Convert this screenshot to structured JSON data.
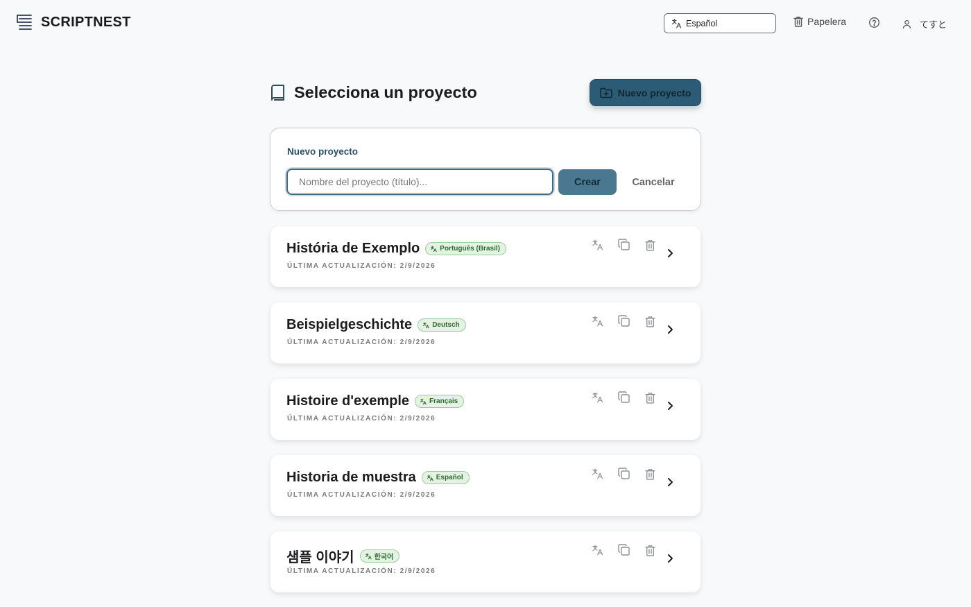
{
  "header": {
    "brand": "SCRIPTNEST",
    "language_selector": "Español",
    "trash_label": "Papelera",
    "user_name": "てすと"
  },
  "page": {
    "title": "Selecciona un proyecto",
    "new_project_button": "Nuevo proyecto"
  },
  "form": {
    "label": "Nuevo proyecto",
    "input_placeholder": "Nombre del proyecto (título)...",
    "input_value": "",
    "create_label": "Crear",
    "cancel_label": "Cancelar"
  },
  "projects": [
    {
      "title": "História de Exemplo",
      "language": "Português (Brasil)",
      "updated": "ÚLTIMA ACTUALIZACIÓN: 2/9/2026"
    },
    {
      "title": "Beispielgeschichte",
      "language": "Deutsch",
      "updated": "ÚLTIMA ACTUALIZACIÓN: 2/9/2026"
    },
    {
      "title": "Histoire d'exemple",
      "language": "Français",
      "updated": "ÚLTIMA ACTUALIZACIÓN: 2/9/2026"
    },
    {
      "title": "Historia de muestra",
      "language": "Español",
      "updated": "ÚLTIMA ACTUALIZACIÓN: 2/9/2026"
    },
    {
      "title": "샘플 이야기",
      "language": "한국어",
      "updated": "ÚLTIMA ACTUALIZACIÓN: 2/9/2026"
    }
  ],
  "colors": {
    "background": "#f8f9fa",
    "primary": "#2c5b75",
    "badge_bg": "#e4f2e4",
    "badge_text": "#2f6b2f"
  },
  "icons": {
    "brand": "stacked-lines-icon",
    "language": "translate-icon",
    "trash": "trash-icon",
    "help": "help-circle-icon",
    "user": "user-icon",
    "book": "book-icon",
    "new_folder": "folder-plus-icon",
    "duplicate": "copy-icon",
    "open": "chevron-right-icon"
  }
}
